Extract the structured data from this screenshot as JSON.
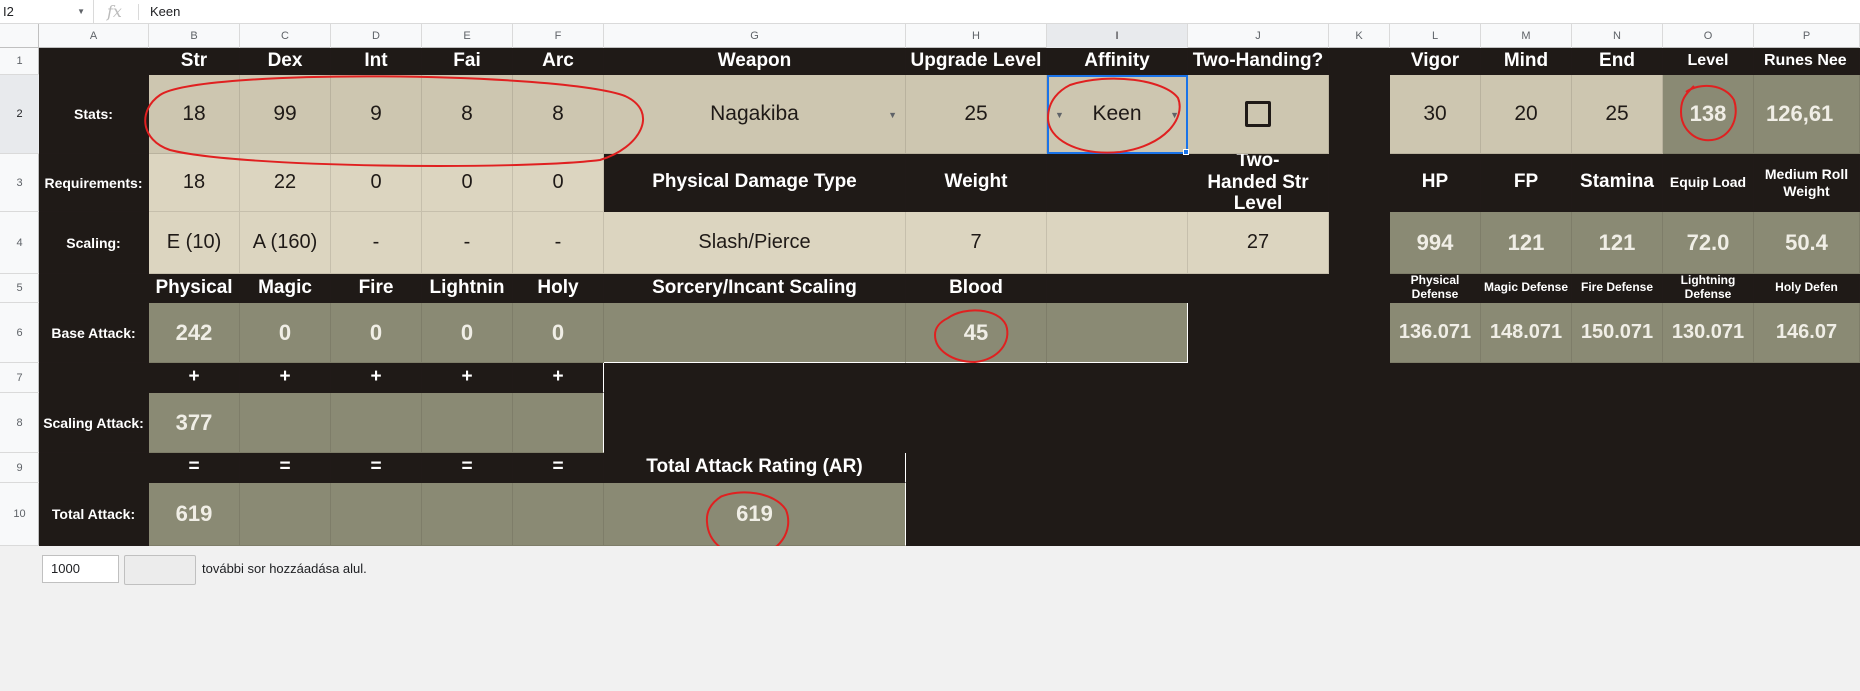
{
  "formula_bar": {
    "cell_ref": "I2",
    "fx": "fx",
    "value": "Keen"
  },
  "columns": [
    "A",
    "B",
    "C",
    "D",
    "E",
    "F",
    "G",
    "H",
    "I",
    "J",
    "K",
    "L",
    "M",
    "N",
    "O",
    "P"
  ],
  "rows": [
    "1",
    "2",
    "3",
    "4",
    "5",
    "6",
    "7",
    "8",
    "9",
    "10"
  ],
  "stats": {
    "header": {
      "str": "Str",
      "dex": "Dex",
      "int": "Int",
      "fai": "Fai",
      "arc": "Arc",
      "weapon": "Weapon",
      "upgrade": "Upgrade Level",
      "affinity": "Affinity",
      "two_handing": "Two-Handing?",
      "vigor": "Vigor",
      "mind": "Mind",
      "end": "End",
      "level": "Level",
      "runes": "Runes Nee"
    },
    "label": "Stats:",
    "values": {
      "str": "18",
      "dex": "99",
      "int": "9",
      "fai": "8",
      "arc": "8",
      "weapon": "Nagakiba",
      "upgrade": "25",
      "affinity": "Keen",
      "two_handing_checked": false,
      "vigor": "30",
      "mind": "20",
      "end": "25",
      "level": "138",
      "runes": "126,61"
    }
  },
  "requirements": {
    "label": "Requirements:",
    "values": {
      "str": "18",
      "dex": "22",
      "int": "0",
      "fai": "0",
      "arc": "0"
    },
    "phys_type_label": "Physical Damage Type",
    "weight_label": "Weight",
    "two_handed_label": "Two-Handed Str Level",
    "hp": "HP",
    "fp": "FP",
    "stamina": "Stamina",
    "equip_load": "Equip Load",
    "medium_roll": "Medium Roll Weight"
  },
  "scaling": {
    "label": "Scaling:",
    "values": {
      "str": "E (10)",
      "dex": "A (160)",
      "int": "-",
      "fai": "-",
      "arc": "-"
    },
    "phys_type": "Slash/Pierce",
    "weight": "7",
    "two_handed_str": "27",
    "hp": "994",
    "fp": "121",
    "stamina": "121",
    "equip_load": "72.0",
    "medium_roll": "50.4"
  },
  "damage_header": {
    "physical": "Physical",
    "magic": "Magic",
    "fire": "Fire",
    "lightning": "Lightnin",
    "holy": "Holy",
    "sorc": "Sorcery/Incant Scaling",
    "blood": "Blood",
    "phys_def": "Physical Defense",
    "magic_def": "Magic Defense",
    "fire_def": "Fire Defense",
    "light_def": "Lightning Defense",
    "holy_def": "Holy Defen"
  },
  "base_attack": {
    "label": "Base Attack:",
    "physical": "242",
    "magic": "0",
    "fire": "0",
    "lightning": "0",
    "holy": "0",
    "blood": "45",
    "phys_def": "136.071",
    "magic_def": "148.071",
    "fire_def": "150.071",
    "light_def": "130.071",
    "holy_def": "146.07"
  },
  "plus": "+",
  "equals": "=",
  "scaling_attack": {
    "label": "Scaling Attack:",
    "physical": "377"
  },
  "total_ar_label": "Total Attack Rating (AR)",
  "total_attack": {
    "label": "Total Attack:",
    "physical": "619",
    "ar": "619"
  },
  "footer": {
    "row_count": "1000",
    "add_text": "további sor hozzáadása alul."
  },
  "colors": {
    "dark": "#1f1a17",
    "tan": "#cdc6b0",
    "light_tan": "#dcd5c0",
    "olive": "#8a8a74",
    "selection": "#1a73e8",
    "annotation": "#e02020"
  },
  "icons": {
    "fx": "function-icon",
    "dropdown": "dropdown-arrow-icon"
  }
}
